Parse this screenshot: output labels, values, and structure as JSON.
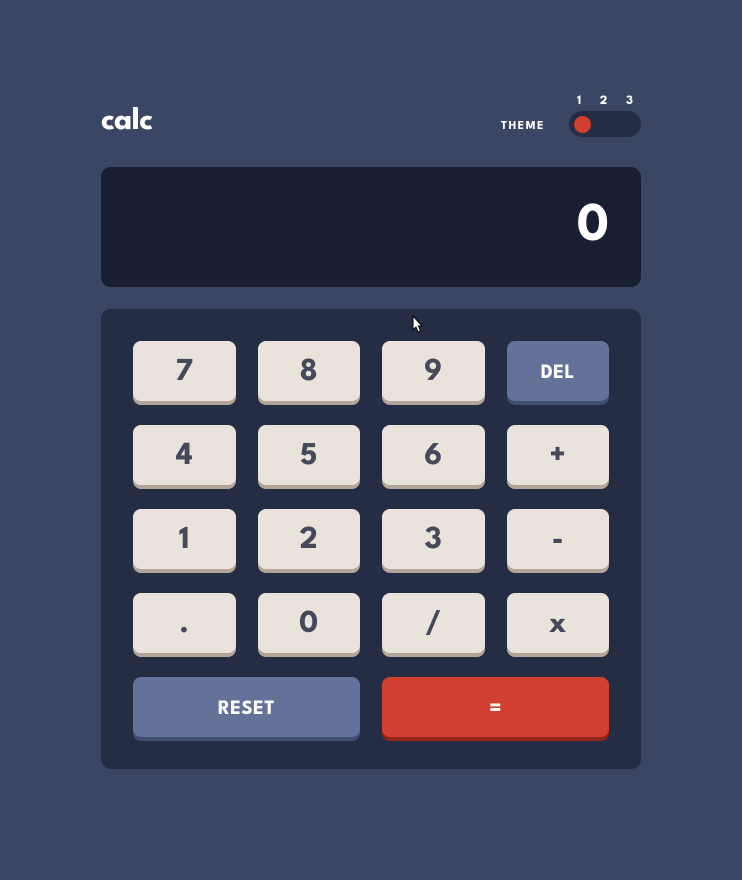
{
  "header": {
    "title": "calc",
    "theme_label": "THEME",
    "theme_options": {
      "opt1": "1",
      "opt2": "2",
      "opt3": "3"
    },
    "theme_selected": 1
  },
  "display": {
    "value": "0"
  },
  "keys": {
    "seven": "7",
    "eight": "8",
    "nine": "9",
    "del": "DEL",
    "four": "4",
    "five": "5",
    "six": "6",
    "plus": "+",
    "one": "1",
    "two": "2",
    "three": "3",
    "minus": "-",
    "decimal": ".",
    "zero": "0",
    "divide": "/",
    "multiply": "x",
    "reset": "RESET",
    "equals": "="
  },
  "colors": {
    "page_bg": "#3b4664",
    "display_bg": "#181f32",
    "keypad_bg": "#252d44",
    "key_bg": "#eae3db",
    "key_shadow": "#b3a599",
    "key_text": "#45495a",
    "func_bg": "#647299",
    "func_shadow": "#404e74",
    "accent_bg": "#d13f30",
    "accent_shadow": "#922417",
    "text_white": "#ffffff"
  }
}
